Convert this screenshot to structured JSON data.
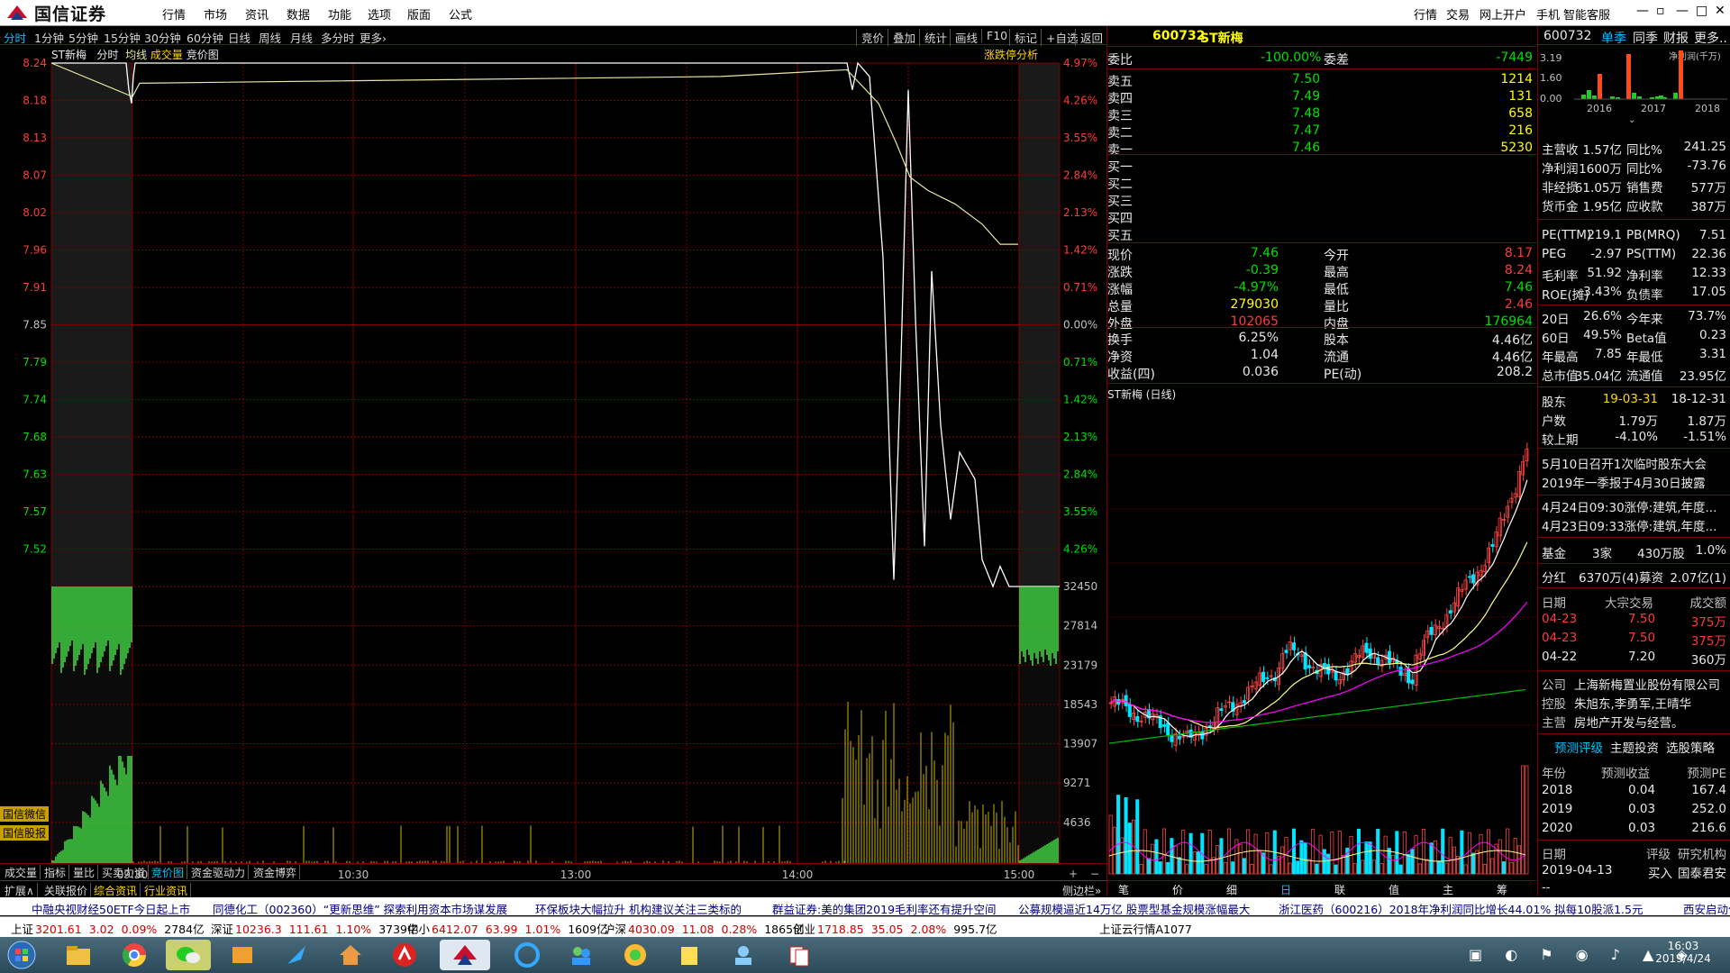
{
  "app": {
    "name": "国信证券"
  },
  "menu": [
    "行情",
    "市场",
    "资讯",
    "数据",
    "功能",
    "选项",
    "版面",
    "公式"
  ],
  "menu_right": [
    "行情",
    "交易",
    "网上开户",
    "手机",
    "智能客服"
  ],
  "window_controls": [
    "—",
    "▫",
    "—",
    "□",
    "✕"
  ],
  "period_tabs": [
    "分时",
    "1分钟",
    "5分钟",
    "15分钟",
    "30分钟",
    "60分钟",
    "日线",
    "周线",
    "月线",
    "多分时",
    "更多›"
  ],
  "right_tools": [
    "竞价",
    "叠加",
    "统计",
    "画线",
    "F10",
    "标记",
    "+自选",
    "返回"
  ],
  "chart_header": {
    "stock": "ST新梅",
    "mode": "分时",
    "tags": [
      "均线",
      "成交量",
      "竞价图"
    ],
    "analysis": "涨跌停分析"
  },
  "price_axis": {
    "left": [
      "8.24",
      "8.18",
      "8.13",
      "8.07",
      "8.02",
      "7.96",
      "7.91",
      "7.85",
      "7.79",
      "7.74",
      "7.68",
      "7.63",
      "7.57",
      "7.52"
    ],
    "right": [
      "4.97%",
      "4.26%",
      "3.55%",
      "2.84%",
      "2.13%",
      "1.42%",
      "0.71%",
      "0.00%",
      "0.71%",
      "1.42%",
      "2.13%",
      "2.84%",
      "3.55%",
      "4.26%"
    ]
  },
  "volume_axis": [
    "32450",
    "27814",
    "23179",
    "18543",
    "13907",
    "9271",
    "4636"
  ],
  "time_axis": [
    "09:30",
    "10:30",
    "13:00",
    "14:00",
    "15:00"
  ],
  "side_labels": [
    "国信微信",
    "国信股报"
  ],
  "bottom_tabs": [
    "成交量",
    "指标",
    "量比",
    "买卖力道",
    "竞价图",
    "资金驱动力",
    "资金博弈"
  ],
  "bottom_tabs2": [
    "扩展∧",
    "关联报价",
    "综合资讯",
    "行业资讯"
  ],
  "quote": {
    "code": "600732",
    "name": "ST新梅",
    "weibi_label": "委比",
    "weibi": "-100.00%",
    "weicha_label": "委差",
    "weicha": "-7449",
    "asks": [
      {
        "label": "卖五",
        "price": "7.50",
        "vol": "1214"
      },
      {
        "label": "卖四",
        "price": "7.49",
        "vol": "131"
      },
      {
        "label": "卖三",
        "price": "7.48",
        "vol": "658"
      },
      {
        "label": "卖二",
        "price": "7.47",
        "vol": "216"
      },
      {
        "label": "卖一",
        "price": "7.46",
        "vol": "5230"
      }
    ],
    "bids": [
      "买一",
      "买二",
      "买三",
      "买四",
      "买五"
    ],
    "stats": [
      [
        "现价",
        "7.46",
        "今开",
        "8.17"
      ],
      [
        "涨跌",
        "-0.39",
        "最高",
        "8.24"
      ],
      [
        "涨幅",
        "-4.97%",
        "最低",
        "7.46"
      ],
      [
        "总量",
        "279030",
        "量比",
        "2.46"
      ],
      [
        "外盘",
        "102065",
        "内盘",
        "176964"
      ]
    ],
    "stats2": [
      [
        "换手",
        "6.25%",
        "股本",
        "4.46亿"
      ],
      [
        "净资",
        "1.04",
        "流通",
        "4.46亿"
      ],
      [
        "收益(四)",
        "0.036",
        "PE(动)",
        "208.2"
      ]
    ],
    "kline_title": "ST新梅 (日线)"
  },
  "mini_tabs": [
    "笔",
    "价",
    "细",
    "日",
    "联",
    "值",
    "主",
    "筹"
  ],
  "side_bottom": "侧边栏»",
  "fin": {
    "code": "600732",
    "tabs": [
      "单季",
      "同季",
      "财报",
      "更多.."
    ],
    "chart_axis": [
      "3.19",
      "1.60",
      "0.00"
    ],
    "chart_label": "净利润(千万)",
    "years": [
      "2016",
      "2017",
      "2018"
    ],
    "rows1": [
      [
        "主营收",
        "1.57亿",
        "同比%",
        "241.25"
      ],
      [
        "净利润",
        "1600万",
        "同比%",
        "-73.76"
      ],
      [
        "非经损",
        "61.05万",
        "销售费",
        "577万"
      ],
      [
        "货币金",
        "1.95亿",
        "应收款",
        "387万"
      ]
    ],
    "rows2": [
      [
        "PE(TTM)",
        "219.1",
        "PB(MRQ)",
        "7.51"
      ],
      [
        "PEG",
        "-2.97",
        "PS(TTM)",
        "22.36"
      ],
      [
        "毛利率",
        "51.92",
        "净利率",
        "12.33"
      ],
      [
        "ROE(摊)",
        "3.43%",
        "负债率",
        "17.05"
      ]
    ],
    "rows3": [
      [
        "20日",
        "26.6%",
        "今年来",
        "73.7%"
      ],
      [
        "60日",
        "49.5%",
        "Beta值",
        "0.23"
      ],
      [
        "年最高",
        "7.85",
        "年最低",
        "3.31"
      ],
      [
        "总市值",
        "35.04亿",
        "流通值",
        "23.95亿"
      ]
    ],
    "holders": [
      [
        "股东",
        "19-03-31",
        "18-12-31"
      ],
      [
        "户数",
        "1.79万",
        "1.87万"
      ],
      [
        "较上期",
        "-4.10%",
        "-1.51%"
      ]
    ],
    "notes": [
      "5月10日召开1次临时股东大会",
      "2019年一季报于4月30日披露",
      "4月24日09:30涨停:建筑,年度...",
      "4月23日09:33涨停:建筑,年度..."
    ],
    "fund": [
      "基金",
      "3家",
      "430万股",
      "1.0%"
    ],
    "share": [
      "分红",
      "6370万(4)募资",
      "2.07亿(1)"
    ],
    "block_header": [
      "日期",
      "大宗交易",
      "成交额"
    ],
    "block": [
      [
        "04-23",
        "7.50",
        "375万"
      ],
      [
        "04-23",
        "7.50",
        "375万"
      ],
      [
        "04-22",
        "7.20",
        "360万"
      ]
    ],
    "company": [
      [
        "公司",
        "上海新梅置业股份有限公司"
      ],
      [
        "控股",
        "朱旭东,李勇军,王晴华"
      ],
      [
        "主营",
        "房地产开发与经营。"
      ]
    ],
    "rating_tabs": [
      "预测评级",
      "主题投资",
      "选股策略"
    ],
    "forecast_header": [
      "年份",
      "预测收益",
      "预测PE"
    ],
    "forecast": [
      [
        "2018",
        "0.04",
        "167.4"
      ],
      [
        "2019",
        "0.03",
        "252.0"
      ],
      [
        "2020",
        "0.03",
        "216.6"
      ]
    ],
    "rating_header": [
      "日期",
      "评级",
      "研究机构"
    ],
    "rating": [
      "2019-04-13",
      "买入",
      "国泰君安"
    ],
    "dash": "--"
  },
  "news": [
    "中融央视财经50ETF今日起上市",
    "同德化工（002360）“更新思维” 探索利用资本市场谋发展",
    "环保板块大幅拉升 机构建议关注三类标的",
    "群益证券:美的集团2019毛利率还有提升空间",
    "公募规模逼近14万亿 股票型基金规模涨幅最大",
    "浙江医药（600216）2018年净利润同比增长44.01% 拟每10股派1.5元",
    "西安启动住房公积"
  ],
  "indices": [
    {
      "name": "上证",
      "val": "3201.61",
      "chg": "3.02",
      "pct": "0.09%",
      "amt": "2784亿"
    },
    {
      "name": "深证",
      "val": "10236.3",
      "chg": "111.61",
      "pct": "1.10%",
      "amt": "3739亿"
    },
    {
      "name": "中小",
      "val": "6412.07",
      "chg": "63.99",
      "pct": "1.01%",
      "amt": "1609亿"
    },
    {
      "name": "沪深",
      "val": "4030.09",
      "chg": "11.08",
      "pct": "0.28%",
      "amt": "1865亿"
    },
    {
      "name": "创业",
      "val": "1718.85",
      "chg": "35.05",
      "pct": "2.08%",
      "amt": "995.7亿"
    }
  ],
  "cloud": "上证云行情A1077",
  "clock": {
    "time": "16:03",
    "date": "2019/4/24"
  },
  "colors": {
    "up": "#ff3b3b",
    "down": "#00e000",
    "grid": "#800000",
    "price": "#ffffff",
    "avg": "#e8e8a0"
  }
}
